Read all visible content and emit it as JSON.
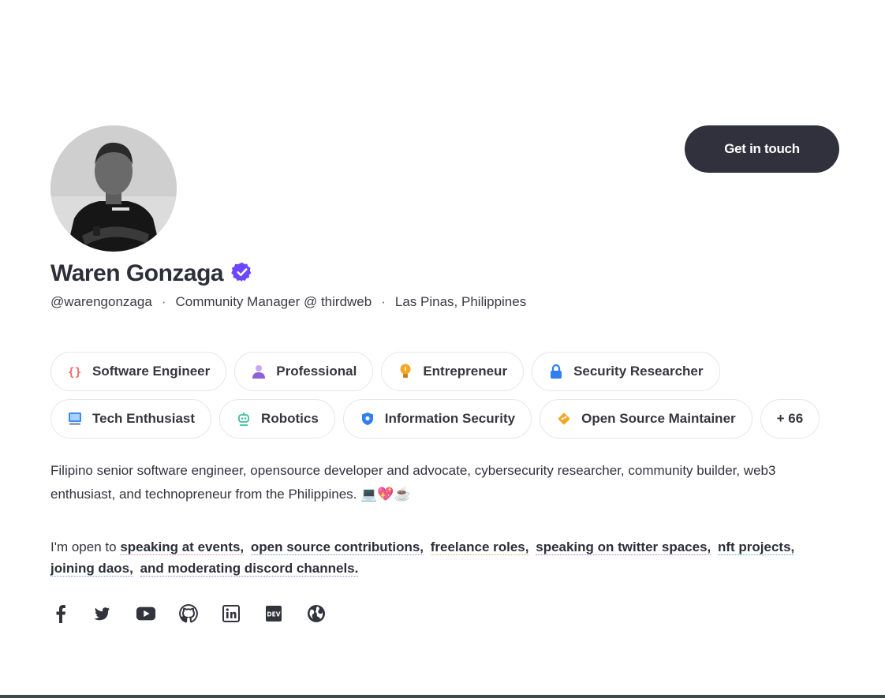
{
  "profile": {
    "name": "Waren Gonzaga",
    "handle": "@warengonzaga",
    "role": "Community Manager @ thirdweb",
    "location": "Las Pinas, Philippines",
    "separator": "·",
    "avatar_icon": "user-photo",
    "verified_icon": "verified-badge-icon"
  },
  "cta": {
    "label": "Get in touch"
  },
  "chips": {
    "row1": [
      {
        "label": "Software Engineer",
        "icon": "code-braces-icon"
      },
      {
        "label": "Professional",
        "icon": "person-icon"
      },
      {
        "label": "Entrepreneur",
        "icon": "lightbulb-icon"
      },
      {
        "label": "Security Researcher",
        "icon": "lock-icon"
      }
    ],
    "row2": [
      {
        "label": "Tech Enthusiast",
        "icon": "computer-icon"
      },
      {
        "label": "Robotics",
        "icon": "robot-icon"
      },
      {
        "label": "Information Security",
        "icon": "shield-icon"
      },
      {
        "label": "Open Source Maintainer",
        "icon": "git-icon"
      }
    ],
    "more": "+ 66"
  },
  "bio": {
    "text": "Filipino senior software engineer, opensource developer and advocate, cybersecurity researcher, community builder, web3 enthusiast, and technopreneur from the Philippines.",
    "emojis": "💻💖☕"
  },
  "open_to": {
    "prefix": "I'm open to",
    "items": [
      "speaking at events,",
      "open source contributions,",
      "freelance roles,",
      "speaking on twitter spaces,",
      "nft projects,",
      "joining daos,",
      "and moderating discord channels."
    ]
  },
  "socials": [
    "facebook-icon",
    "twitter-icon",
    "youtube-icon",
    "github-icon",
    "linkedin-icon",
    "dev-icon",
    "globe-icon"
  ],
  "colors": {
    "button_bg": "#31313d",
    "text": "#2e2e3a",
    "verified": "#6c47ff",
    "chip_border": "#e6e6ea"
  }
}
